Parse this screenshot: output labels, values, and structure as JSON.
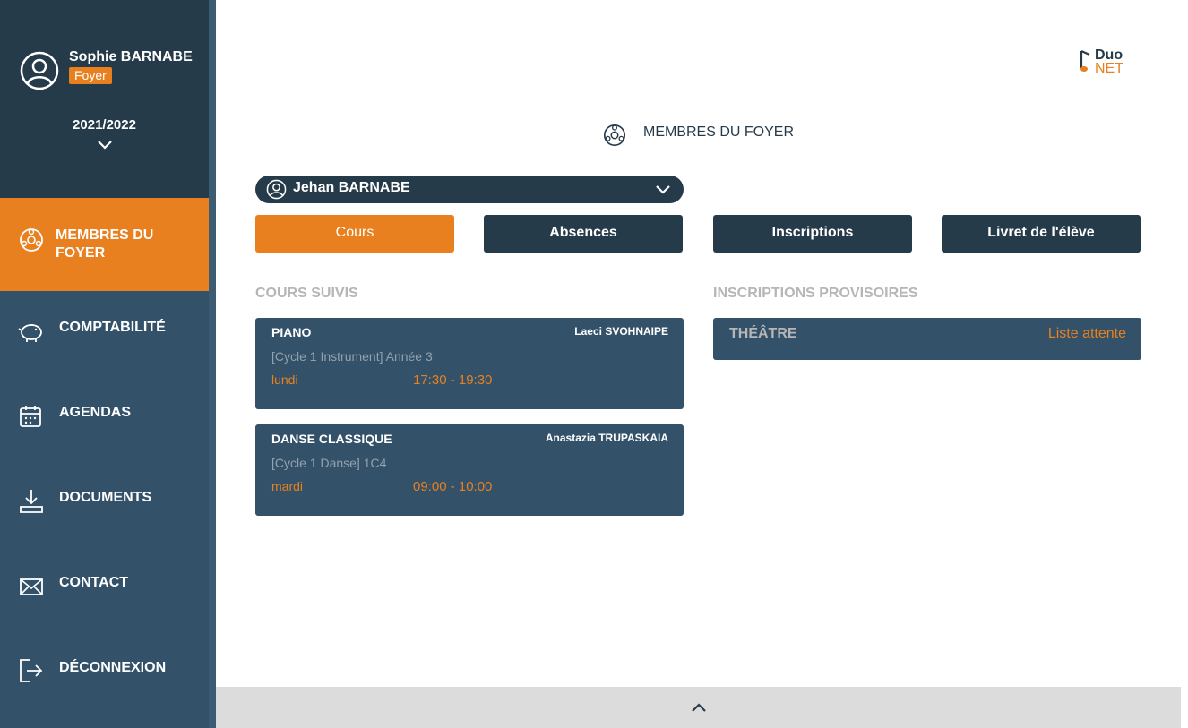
{
  "user": {
    "name": "Sophie BARNABE",
    "role": "Foyer",
    "year": "2021/2022"
  },
  "sidebar": {
    "items": [
      {
        "label_line1": "MEMBRES DU",
        "label_line2": "FOYER",
        "icon": "household-icon",
        "active": true
      },
      {
        "label": "COMPTABILITÉ",
        "icon": "piggy-bank-icon"
      },
      {
        "label": "AGENDAS",
        "icon": "calendar-icon"
      },
      {
        "label": "DOCUMENTS",
        "icon": "download-icon"
      },
      {
        "label": "CONTACT",
        "icon": "envelope-icon"
      },
      {
        "label": "DÉCONNEXION",
        "icon": "logout-icon"
      }
    ]
  },
  "logo": {
    "part1": "Duo",
    "part2": "NET"
  },
  "page_title": "MEMBRES DU FOYER",
  "member_select": {
    "selected": "Jehan BARNABE"
  },
  "tabs": [
    {
      "label": "Cours",
      "active": true
    },
    {
      "label": "Absences"
    },
    {
      "label": "Inscriptions"
    },
    {
      "label": "Livret de l'élève"
    }
  ],
  "courses": {
    "title": "COURS SUIVIS",
    "items": [
      {
        "name": "PIANO",
        "teacher": "Laeci SVOHNAIPE",
        "detail": "[Cycle 1 Instrument] Année 3",
        "day": "lundi",
        "time": "17:30 - 19:30"
      },
      {
        "name": "DANSE CLASSIQUE",
        "teacher": "Anastazia TRUPASKAIA",
        "detail": "[Cycle 1 Danse] 1C4",
        "day": "mardi",
        "time": "09:00 - 10:00"
      }
    ]
  },
  "provisional": {
    "title": "INSCRIPTIONS PROVISOIRES",
    "items": [
      {
        "name": "THÉÂTRE",
        "status": "Liste attente"
      }
    ]
  },
  "colors": {
    "accent": "#e8801f",
    "dark": "#263b4a",
    "sidebar": "#33526a"
  }
}
